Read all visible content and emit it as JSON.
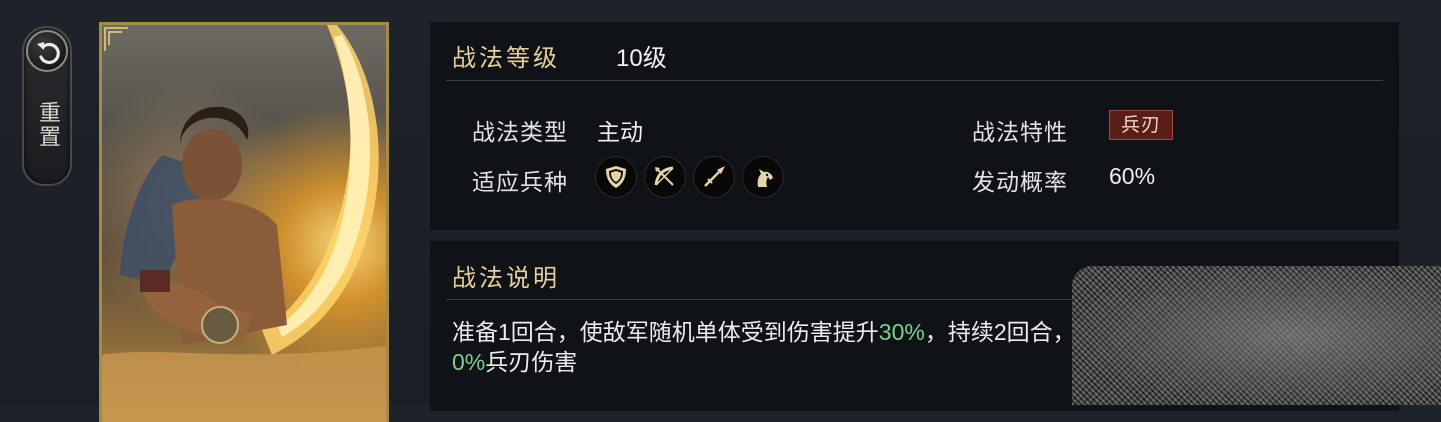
{
  "reset": {
    "label": "重置"
  },
  "skill_info": {
    "level_heading": "战法等级",
    "level_value": "10级",
    "type_label": "战法类型",
    "type_value": "主动",
    "trait_label": "战法特性",
    "trait_badge": "兵刃",
    "units_label": "适应兵种",
    "units": [
      {
        "icon": "shield-icon"
      },
      {
        "icon": "bow-icon"
      },
      {
        "icon": "spear-icon"
      },
      {
        "icon": "horse-icon"
      }
    ],
    "rate_label": "发动概率",
    "rate_value": "60%"
  },
  "description": {
    "heading": "战法说明",
    "segments": [
      {
        "text": "准备1回合，使敌军随机单体受到伤害提升",
        "highlight": false
      },
      {
        "text": "30%",
        "highlight": true
      },
      {
        "text": "，持续2回合，",
        "highlight": false
      },
      {
        "text": "0%",
        "highlight": true
      },
      {
        "text": "兵刃伤害",
        "highlight": false
      }
    ]
  },
  "colors": {
    "heading_gold": "#e6cf9a",
    "highlight_green": "#7ed08a",
    "trait_badge_bg": "#5a1d17"
  }
}
